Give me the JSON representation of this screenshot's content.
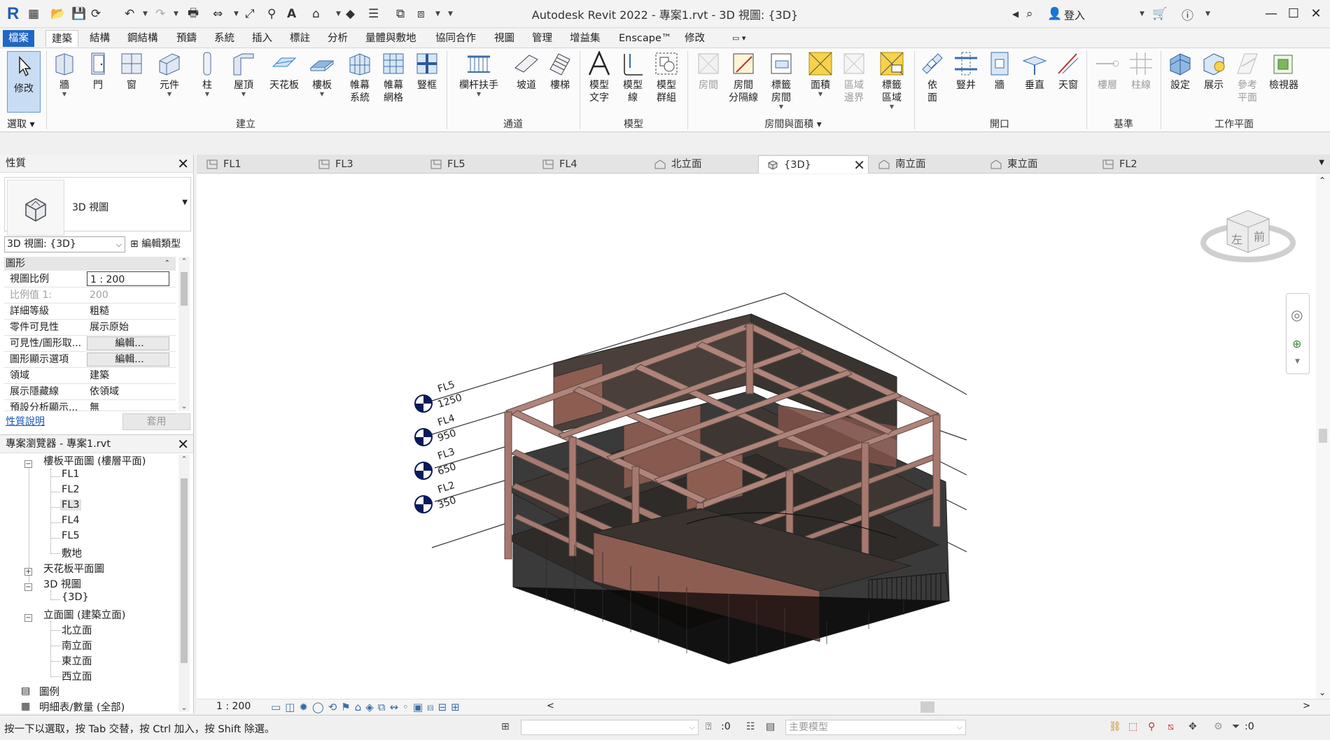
{
  "titlebar": {
    "title": "Autodesk Revit 2022 - 專案1.rvt - 3D 視圖: {3D}",
    "signin": "登入"
  },
  "menu": [
    "檔案",
    "建築",
    "結構",
    "鋼結構",
    "預鑄",
    "系統",
    "插入",
    "標註",
    "分析",
    "量體與敷地",
    "協同合作",
    "視圖",
    "管理",
    "增益集",
    "Enscape™",
    "修改"
  ],
  "ribbon": {
    "modify": "修改",
    "select": "選取",
    "groups": {
      "build": "建立",
      "circulation": "通道",
      "model": "模型",
      "room_area": "房間與面積",
      "opening": "開口",
      "datum": "基準",
      "workplane": "工作平面"
    },
    "buttons": {
      "wall": "牆",
      "door": "門",
      "window": "窗",
      "component": "元件",
      "column": "柱",
      "roof": "屋頂",
      "ceiling": "天花板",
      "floor": "樓板",
      "cw_system_1": "帷幕",
      "cw_system_2": "系統",
      "cw_grid_1": "帷幕",
      "cw_grid_2": "網格",
      "mullion": "豎框",
      "railing": "欄杆扶手",
      "ramp": "坡道",
      "stair": "樓梯",
      "model_text_1": "模型",
      "model_text_2": "文字",
      "model_line_1": "模型",
      "model_line_2": "線",
      "model_group_1": "模型",
      "model_group_2": "群組",
      "room": "房間",
      "room_sep_1": "房間",
      "room_sep_2": "分隔線",
      "tag_room_1": "標籤",
      "tag_room_2": "房間",
      "area": "面積",
      "area_boundary_1": "區域",
      "area_boundary_2": "邊界",
      "tag_area_1": "標籤",
      "tag_area_2": "區域",
      "by_face_1": "依",
      "by_face_2": "面",
      "shaft": "豎井",
      "wall_opening": "牆",
      "vertical": "垂直",
      "dormer": "天窗",
      "level": "樓層",
      "grid": "柱線",
      "set": "設定",
      "show": "展示",
      "ref_plane_1": "參考",
      "ref_plane_2": "平面",
      "viewer": "檢視器"
    }
  },
  "properties": {
    "title": "性質",
    "type_name": "3D 視圖",
    "view_selector": "3D 視圖: {3D}",
    "edit_type": "編輯類型",
    "section": "圖形",
    "rows": [
      {
        "k": "視圖比例",
        "v": "1 : 200"
      },
      {
        "k": "比例值 1:",
        "v": "200"
      },
      {
        "k": "詳細等級",
        "v": "粗糙"
      },
      {
        "k": "零件可見性",
        "v": "展示原始"
      },
      {
        "k": "可見性/圖形取...",
        "v": "編輯..."
      },
      {
        "k": "圖形顯示選項",
        "v": "編輯..."
      },
      {
        "k": "領域",
        "v": "建築"
      },
      {
        "k": "展示隱藏線",
        "v": "依領域"
      },
      {
        "k": "預設分析顯示...",
        "v": "無"
      }
    ],
    "help": "性質說明",
    "apply": "套用"
  },
  "browser": {
    "title": "專案瀏覽器 - 專案1.rvt",
    "floor_plans": "樓板平面圖 (樓層平面)",
    "floor_plan_items": [
      "FL1",
      "FL2",
      "FL3",
      "FL4",
      "FL5",
      "敷地"
    ],
    "ceiling_plans": "天花板平面圖",
    "views_3d": "3D 視圖",
    "view_3d_item": "{3D}",
    "elevations": "立面圖 (建築立面)",
    "elevation_items": [
      "北立面",
      "南立面",
      "東立面",
      "西立面"
    ],
    "legends": "圖例",
    "schedules": "明細表/數量 (全部)"
  },
  "view_tabs": [
    "FL1",
    "FL3",
    "FL5",
    "FL4",
    "北立面",
    "{3D}",
    "南立面",
    "東立面",
    "FL2"
  ],
  "levels": [
    {
      "name": "FL5",
      "elev": "1250"
    },
    {
      "name": "FL4",
      "elev": "950"
    },
    {
      "name": "FL3",
      "elev": "650"
    },
    {
      "name": "FL2",
      "elev": "350"
    }
  ],
  "viewcube": {
    "left": "左",
    "front": "前"
  },
  "view_control": {
    "scale": "1 : 200"
  },
  "status": {
    "hint": "按一下以選取，按 Tab 交替，按 Ctrl 加入，按 Shift 除選。",
    "count_left": ":0",
    "model": "主要模型",
    "filter_count": ":0"
  },
  "colors": {
    "accent": "#1f66c6",
    "brick": "#8e5d52",
    "frame": "#b0847a"
  }
}
